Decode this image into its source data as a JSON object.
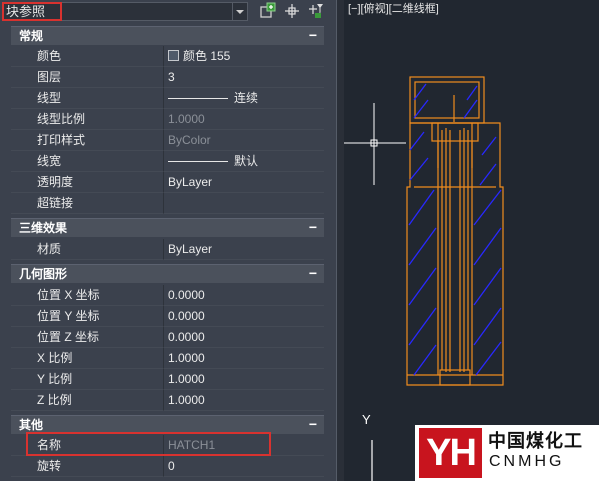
{
  "palette": {
    "selector_value": "块参照",
    "toolbar": {
      "quick_select_label": "",
      "pick_label": "",
      "toggle_label": ""
    },
    "sections": {
      "general": {
        "title": "常规",
        "collapse": "−",
        "rows": [
          {
            "label": "颜色",
            "value": "颜色 155"
          },
          {
            "label": "图层",
            "value": "3"
          },
          {
            "label": "线型",
            "value": "连续"
          },
          {
            "label": "线型比例",
            "value": "1.0000"
          },
          {
            "label": "打印样式",
            "value": "ByColor"
          },
          {
            "label": "线宽",
            "value": "默认"
          },
          {
            "label": "透明度",
            "value": "ByLayer"
          },
          {
            "label": "超链接",
            "value": ""
          }
        ]
      },
      "threed": {
        "title": "三维效果",
        "collapse": "−",
        "rows": [
          {
            "label": "材质",
            "value": "ByLayer"
          }
        ]
      },
      "geometry": {
        "title": "几何图形",
        "collapse": "−",
        "rows": [
          {
            "label": "位置 X 坐标",
            "value": "0.0000"
          },
          {
            "label": "位置 Y 坐标",
            "value": "0.0000"
          },
          {
            "label": "位置 Z 坐标",
            "value": "0.0000"
          },
          {
            "label": "X 比例",
            "value": "1.0000"
          },
          {
            "label": "Y 比例",
            "value": "1.0000"
          },
          {
            "label": "Z 比例",
            "value": "1.0000"
          }
        ]
      },
      "misc": {
        "title": "其他",
        "collapse": "−",
        "rows": [
          {
            "label": "名称",
            "value": "HATCH1"
          },
          {
            "label": "旋转",
            "value": "0"
          }
        ]
      }
    }
  },
  "viewport": {
    "label": "[−][俯视][二维线框]",
    "axis_label": "Y"
  },
  "watermark": {
    "logo_text": "YH",
    "cn_text": "中国煤化工",
    "en_text": "CNMHG"
  },
  "colors": {
    "highlight": "#d8322f",
    "outline": "#f08c1e",
    "hatch": "#2828ff",
    "accent_logo": "#c8141e"
  }
}
